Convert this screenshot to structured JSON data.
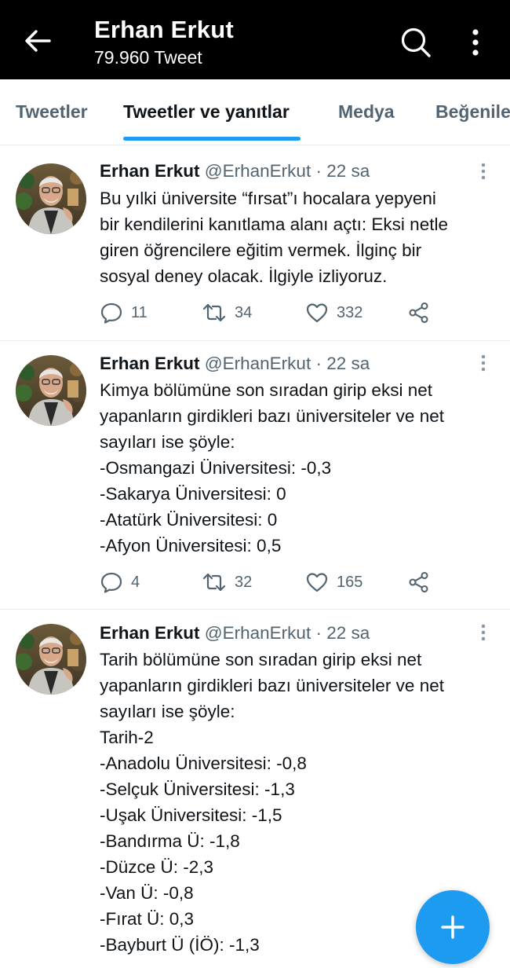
{
  "header": {
    "name": "Erhan Erkut",
    "tweet_count": "79.960 Tweet"
  },
  "tabs": [
    {
      "label": "Tweetler"
    },
    {
      "label": "Tweetler ve yanıtlar"
    },
    {
      "label": "Medya"
    },
    {
      "label": "Beğeniler"
    }
  ],
  "tweets": [
    {
      "name": "Erhan Erkut",
      "meta": "@ErhanErkut · 22 sa",
      "lines": [
        "Bu yılki üniversite “fırsat”ı hocalara yepyeni",
        "bir kendilerini kanıtlama alanı açtı: Eksi netle",
        "giren öğrencilere eğitim vermek. İlginç bir",
        "sosyal deney olacak. İlgiyle izliyoruz."
      ],
      "replies": "11",
      "retweets": "34",
      "likes": "332"
    },
    {
      "name": "Erhan Erkut",
      "meta": "@ErhanErkut · 22 sa",
      "lines": [
        "Kimya bölümüne son sıradan girip eksi net",
        "yapanların girdikleri bazı üniversiteler ve net",
        "sayıları ise şöyle:",
        "-Osmangazi Üniversitesi: -0,3",
        "-Sakarya Üniversitesi: 0",
        "-Atatürk Üniversitesi: 0",
        "-Afyon Üniversitesi: 0,5"
      ],
      "replies": "4",
      "retweets": "32",
      "likes": "165"
    },
    {
      "name": "Erhan Erkut",
      "meta": "@ErhanErkut · 22 sa",
      "lines": [
        "Tarih bölümüne son sıradan girip eksi net",
        "yapanların girdikleri bazı üniversiteler ve net",
        "sayıları ise şöyle:",
        "Tarih-2",
        "-Anadolu Üniversitesi: -0,8",
        "-Selçuk Üniversitesi: -1,3",
        "-Uşak Üniversitesi: -1,5",
        "-Bandırma Ü: -1,8",
        "-Düzce Ü: -2,3",
        "-Van Ü: -0,8",
        "-Fırat Ü: 0,3",
        "-Bayburt Ü (İÖ): -1,3"
      ]
    }
  ],
  "colors": {
    "accent": "#1d9bf0",
    "header_bg": "#000000",
    "muted_text": "#536471"
  },
  "icons": [
    "back-arrow-icon",
    "search-icon",
    "more-vertical-icon",
    "reply-icon",
    "retweet-icon",
    "like-icon",
    "share-icon",
    "plus-icon"
  ]
}
